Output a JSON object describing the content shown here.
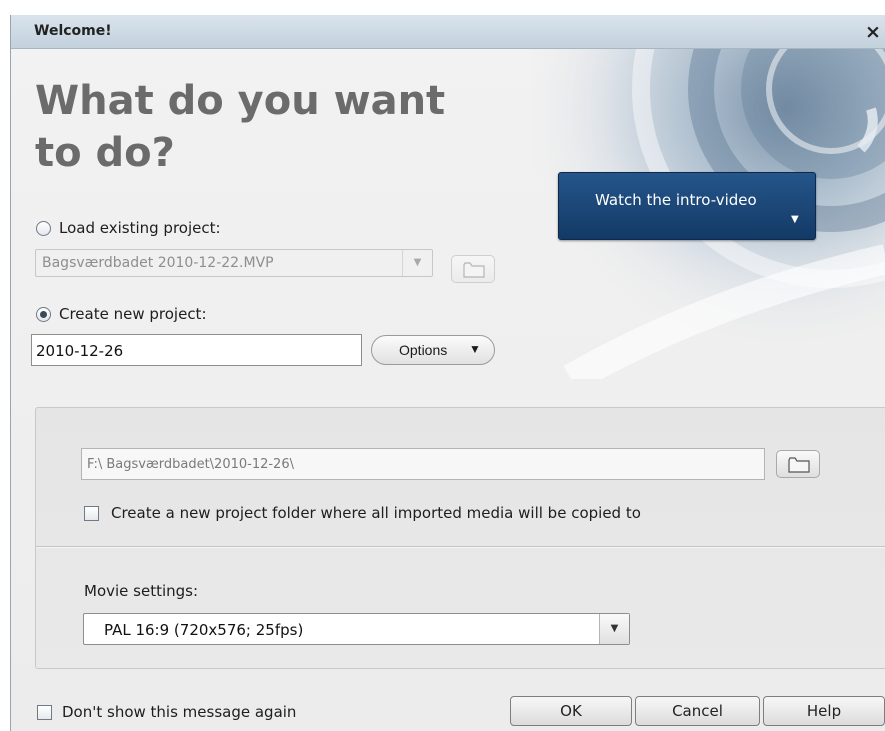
{
  "window": {
    "title": "Welcome!",
    "close_glyph": "×"
  },
  "headline": "What do you want to do?",
  "load_project": {
    "label": "Load existing project:",
    "selected": false,
    "value": "Bagsværdbadet 2010-12-22.MVP"
  },
  "new_project": {
    "label": "Create new project:",
    "selected": true,
    "value": "2010-12-26",
    "options_label": "Options",
    "caret": "▼"
  },
  "intro_button": {
    "label": "Watch the intro-video",
    "caret": "▼"
  },
  "project_folder": {
    "path": "F:\\ Bagsværdbadet\\2010-12-26\\",
    "checkbox_label": "Create a new project folder where all imported media will be copied to",
    "checked": false
  },
  "movie_settings": {
    "label": "Movie settings:",
    "value": "PAL 16:9 (720x576; 25fps)"
  },
  "footer": {
    "dont_show_label": "Don't show this message again",
    "dont_show_checked": false,
    "buttons": {
      "ok": "OK",
      "cancel": "Cancel",
      "help": "Help"
    }
  },
  "icons": {
    "folder": "folder-icon",
    "dropdown": "chevron-down-icon"
  },
  "colors": {
    "accent": "#1c4a7c",
    "headline": "#6b6b6b",
    "titlebar": "#c9d6e1"
  }
}
